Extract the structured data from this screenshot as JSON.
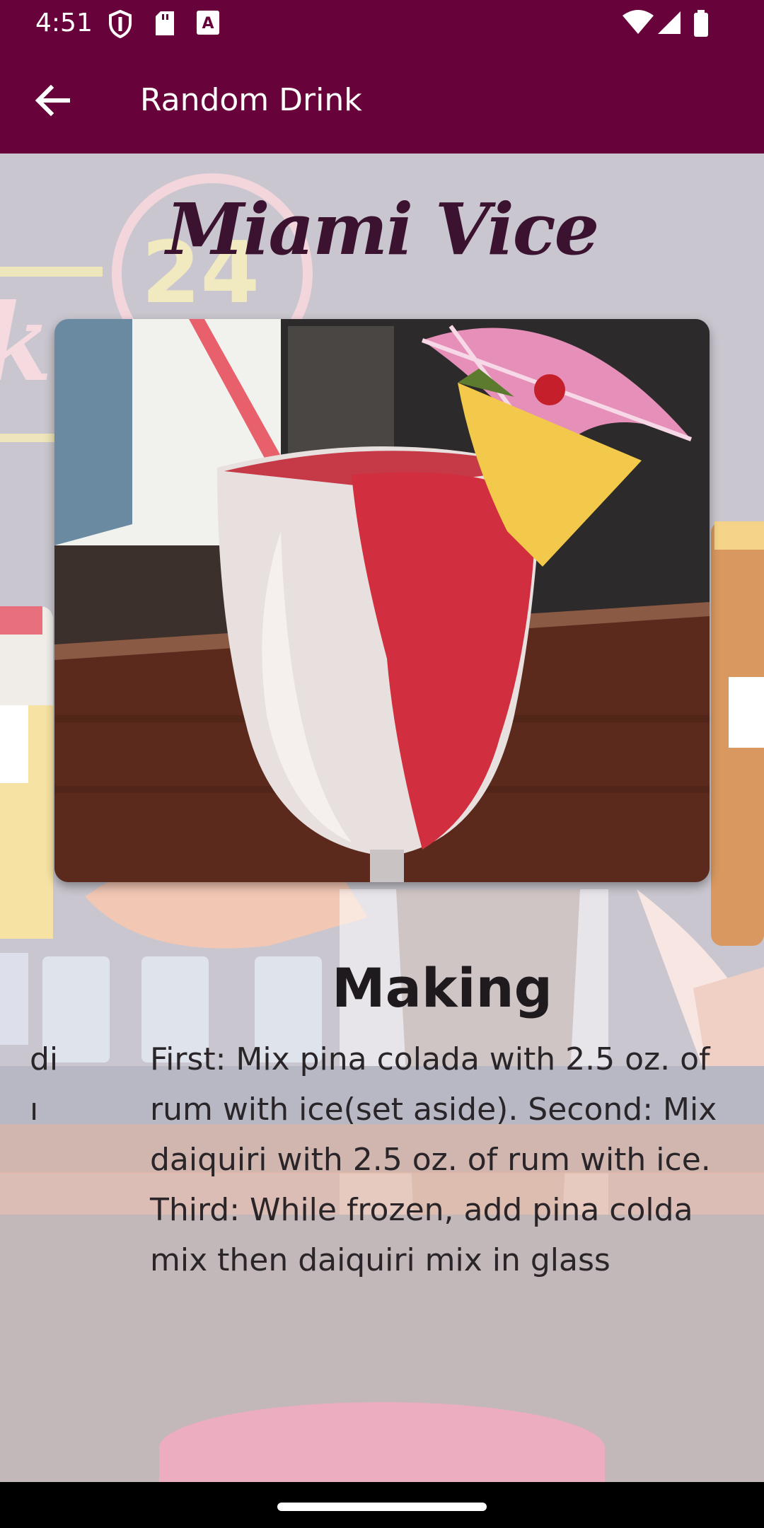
{
  "status_bar": {
    "time": "4:51",
    "left_icons": [
      "shield-icon",
      "sd-card-icon",
      "a-notification-icon"
    ],
    "right_icons": [
      "wifi-icon",
      "signal-icon",
      "battery-icon"
    ]
  },
  "app_bar": {
    "title": "Random Drink",
    "back_icon": "arrow-back-icon",
    "background": "#67033a"
  },
  "drink": {
    "name": "Miami Vice",
    "image_alt": "drink-photo"
  },
  "making": {
    "title": "Making",
    "instructions": "First: Mix pina colada with 2.5 oz. of rum with ice(set aside). Second: Mix daiquiri with 2.5 oz. of rum with ice. Third: While frozen, add pina colda mix then daiquiri mix in glass",
    "offscreen_fragment": "di\nı"
  },
  "colors": {
    "accent": "#67033a",
    "background": "#c5c1c8"
  }
}
